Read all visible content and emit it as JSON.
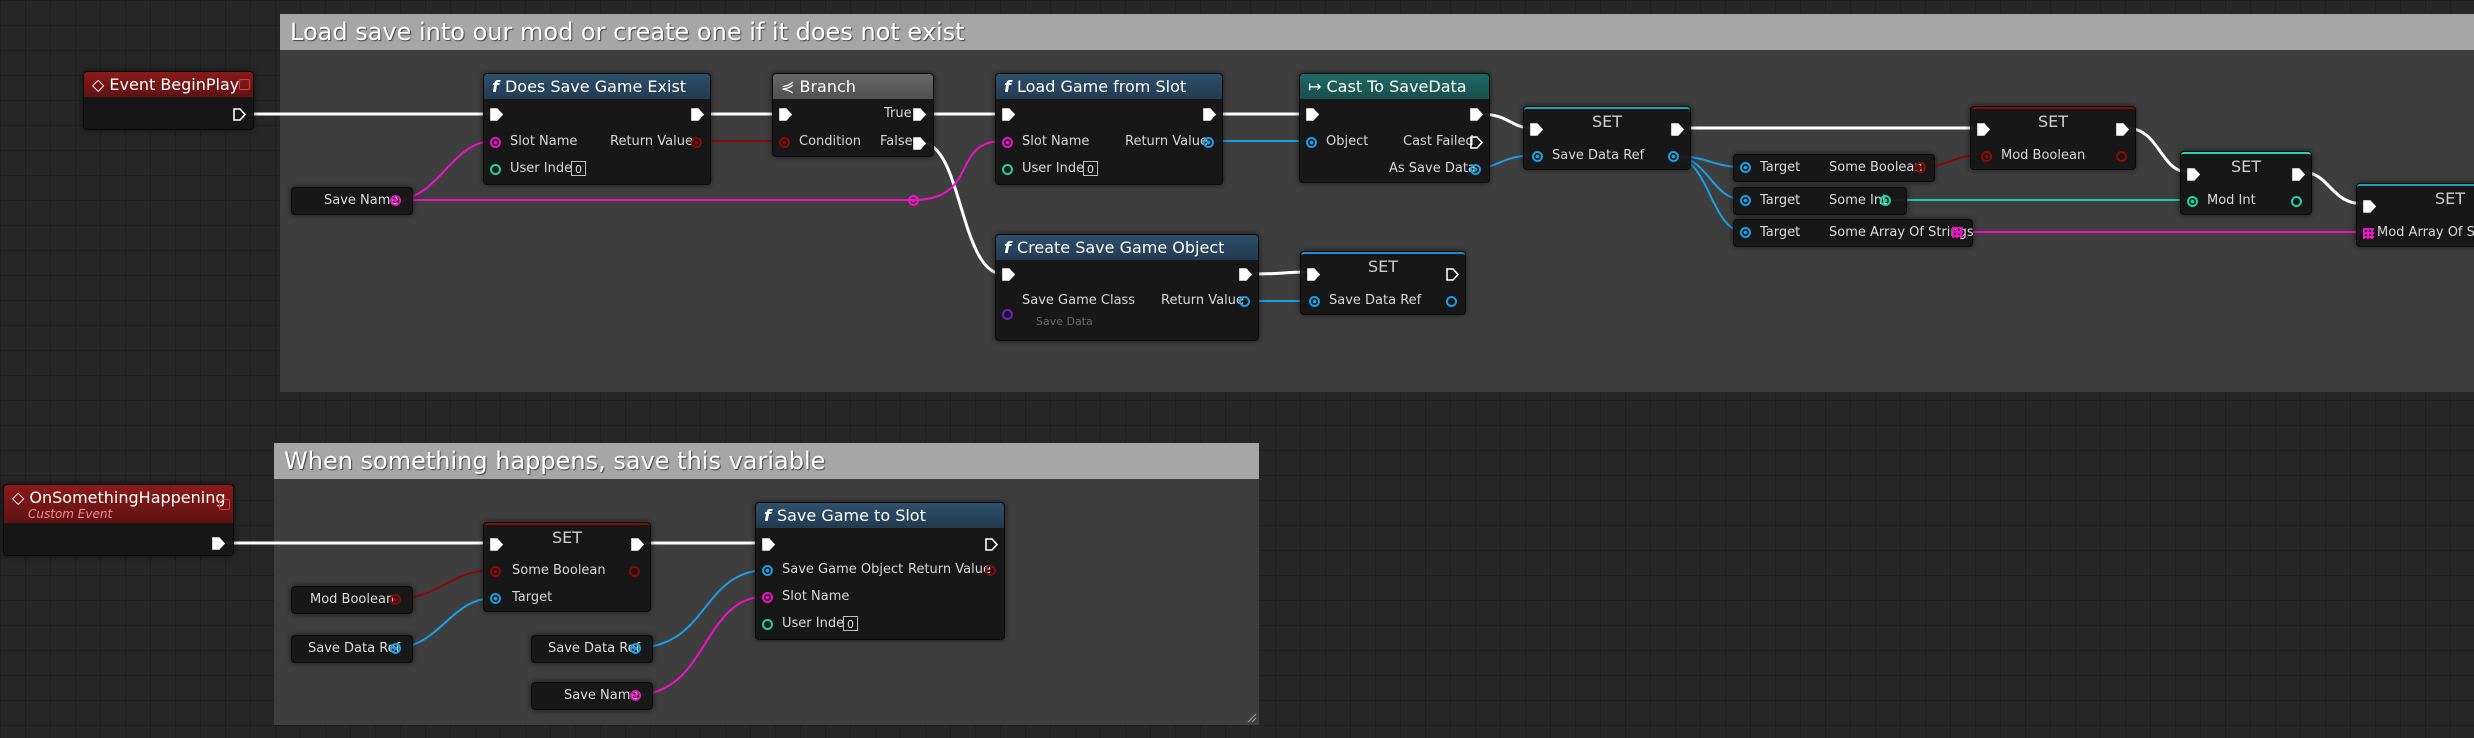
{
  "comments": {
    "top": {
      "title": "Load save into our mod or create one if it does not exist"
    },
    "bottom": {
      "title": "When something happens, save this variable"
    }
  },
  "nodes": {
    "begin_play": {
      "title": "Event BeginPlay"
    },
    "does_save_exist": {
      "title": "Does Save Game Exist",
      "slot_name": "Slot Name",
      "user_index": "User Index",
      "user_index_value": "0",
      "return_value": "Return Value"
    },
    "branch": {
      "title": "Branch",
      "condition": "Condition",
      "true_label": "True",
      "false_label": "False"
    },
    "load_game": {
      "title": "Load Game from Slot",
      "slot_name": "Slot Name",
      "user_index": "User Index",
      "user_index_value": "0",
      "return_value": "Return Value"
    },
    "cast": {
      "title": "Cast To SaveData",
      "object": "Object",
      "cast_failed": "Cast Failed",
      "as_save_data": "As Save Data"
    },
    "set_ref1": {
      "title": "SET",
      "pin": "Save Data Ref"
    },
    "create_save": {
      "title": "Create Save Game Object",
      "class_label": "Save Game Class",
      "class_value": "Save Data",
      "return_value": "Return Value"
    },
    "set_ref2": {
      "title": "SET",
      "pin": "Save Data Ref"
    },
    "target_bool": {
      "target": "Target",
      "value": "Some Boolean"
    },
    "target_int": {
      "target": "Target",
      "value": "Some Int"
    },
    "target_arr": {
      "target": "Target",
      "value": "Some Array Of Strings"
    },
    "set_mod_bool": {
      "title": "SET",
      "pin": "Mod Boolean"
    },
    "set_mod_int": {
      "title": "SET",
      "pin": "Mod Int"
    },
    "set_mod_arr": {
      "title": "SET",
      "pin": "Mod Array Of Strin"
    },
    "save_name_top": {
      "label": "Save Name"
    },
    "on_something": {
      "title": "OnSomethingHappening",
      "subtitle": "Custom Event"
    },
    "set_bottom": {
      "title": "SET",
      "pin1": "Some Boolean",
      "pin2": "Target"
    },
    "mod_boolean_var": {
      "label": "Mod Boolean"
    },
    "save_data_ref_var1": {
      "label": "Save Data Ref"
    },
    "save_game_slot": {
      "title": "Save Game to Slot",
      "save_object": "Save Game Object",
      "slot_name": "Slot Name",
      "user_index": "User Index",
      "user_index_value": "0",
      "return_value": "Return Value"
    },
    "save_data_ref_var2": {
      "label": "Save Data Ref"
    },
    "save_name_bottom": {
      "label": "Save Name"
    }
  },
  "colors": {
    "exec": "#ffffff",
    "object": "#1a9ee4",
    "string": "#ee12c6",
    "boolean": "#8a0a0a",
    "integer": "#1bd3a5",
    "comment_header": "#a6a6a6",
    "comment_body": "#404040"
  }
}
